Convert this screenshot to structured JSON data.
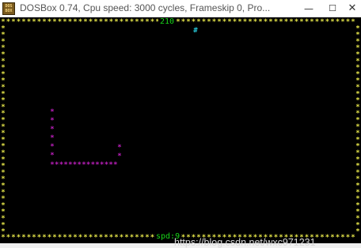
{
  "window": {
    "icon_text": "DOS BOX",
    "title": "DOSBox 0.74, Cpu speed:     3000 cycles, Frameskip  0, Pro...",
    "minimize_glyph": "—",
    "maximize_glyph": "☐",
    "close_glyph": "✕"
  },
  "game": {
    "score": "210",
    "speed_label": "spd:9",
    "food_glyph": "#",
    "border_glyph": "*",
    "snake_glyph": "*",
    "watermark": "https://blog.csdn.net/wxc971231",
    "colors": {
      "background": "#000000",
      "border": "#e6e64a",
      "snake": "#c020c0",
      "food": "#27c6d6",
      "hud": "#19d719"
    }
  }
}
